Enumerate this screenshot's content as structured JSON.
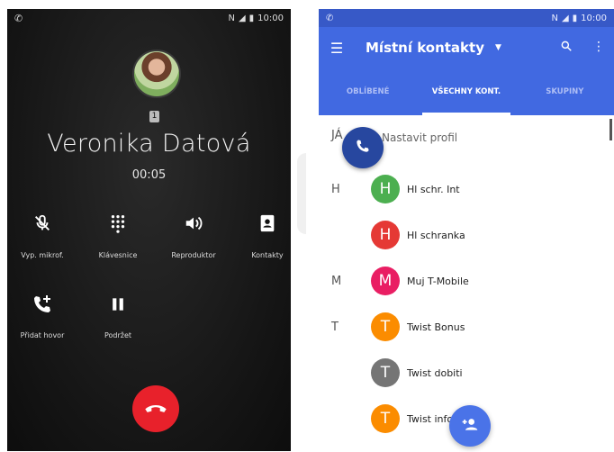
{
  "call_screen": {
    "status_time": "10:00",
    "caller_name": "Veronika Datová",
    "sim_badge": "1",
    "timer": "00:05",
    "controls": [
      {
        "label": "Vyp. mikrof."
      },
      {
        "label": "Klávesnice"
      },
      {
        "label": "Reproduktor"
      },
      {
        "label": "Kontakty"
      },
      {
        "label": "Přidat hovor"
      },
      {
        "label": "Podržet"
      }
    ],
    "end_call_color": "#e8212b"
  },
  "contacts_app": {
    "status_time": "10:00",
    "title": "Místní kontakty",
    "tabs": [
      {
        "label": "OBLÍBENÉ"
      },
      {
        "label": "VŠECHNY KONT."
      },
      {
        "label": "SKUPINY"
      }
    ],
    "active_tab": "VŠECHNY KONT.",
    "profile": {
      "section_letter": "JÁ",
      "text": "Nastavit profil"
    },
    "contacts": [
      {
        "section": "H",
        "initial": "H",
        "name": "Hl schr. Int",
        "color": "#4caf50"
      },
      {
        "section": "",
        "initial": "H",
        "name": "Hl schranka",
        "color": "#e53935"
      },
      {
        "section": "M",
        "initial": "M",
        "name": "Muj T-Mobile",
        "color": "#e91e63"
      },
      {
        "section": "T",
        "initial": "T",
        "name": "Twist Bonus",
        "color": "#fb8c00"
      },
      {
        "section": "",
        "initial": "T",
        "name": "Twist dobiti",
        "color": "#757575"
      },
      {
        "section": "",
        "initial": "T",
        "name": "Twist info",
        "color": "#fb8c00"
      }
    ],
    "accent_color": "#4169e1"
  }
}
